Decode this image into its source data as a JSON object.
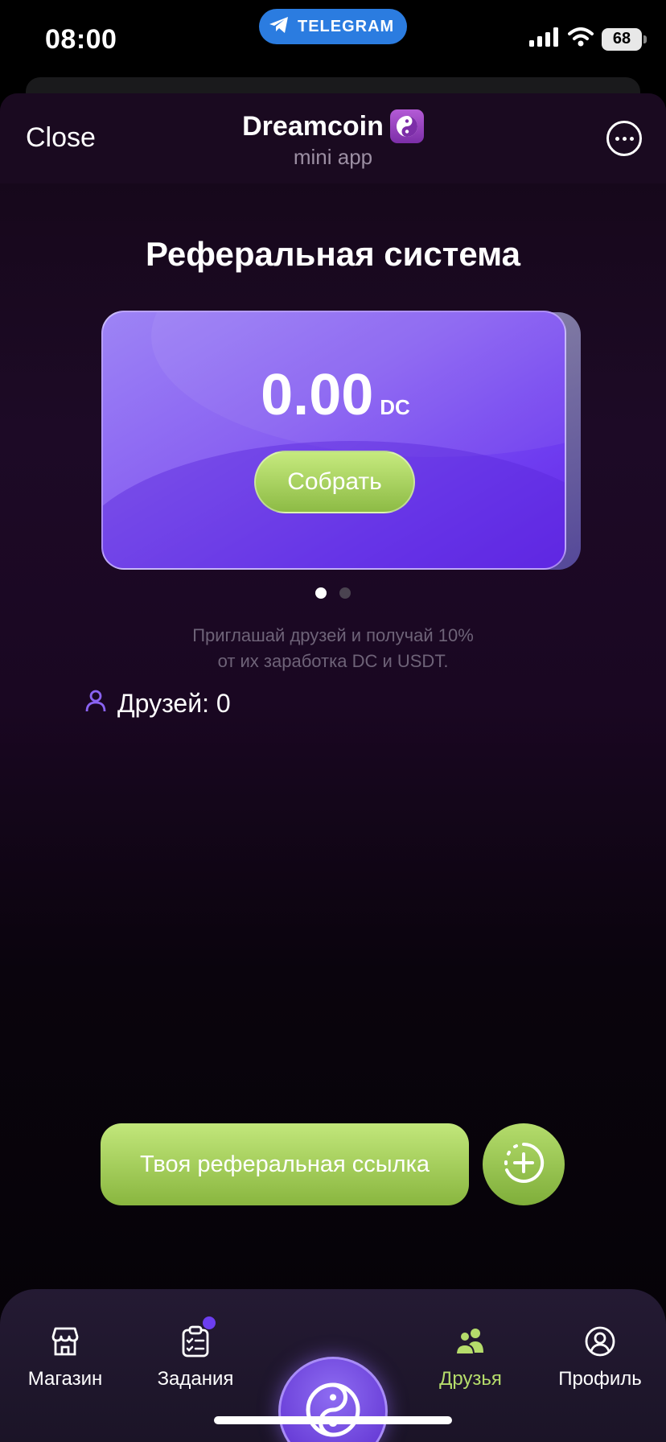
{
  "status_bar": {
    "time": "08:00",
    "pill_label": "TELEGRAM",
    "battery": "68",
    "icons": [
      "signal-icon",
      "wifi-icon",
      "battery-icon"
    ]
  },
  "header": {
    "close_label": "Close",
    "title": "Dreamcoin",
    "subtitle": "mini app",
    "more_icon": "more-icon"
  },
  "page": {
    "title": "Реферальная система"
  },
  "card": {
    "amount": "0.00",
    "unit": "DC",
    "collect_label": "Собрать"
  },
  "carousel": {
    "pages": 2,
    "active_index": 0
  },
  "invite": {
    "line1": "Приглашай друзей и получай 10%",
    "line2": "от их заработка DC и USDT."
  },
  "friends": {
    "label": "Друзей: 0"
  },
  "actions": {
    "ref_link_label": "Твоя реферальная ссылка",
    "add_icon": "add-icon"
  },
  "tabbar": {
    "items": [
      {
        "label": "Магазин",
        "icon": "shop-icon"
      },
      {
        "label": "Задания",
        "icon": "tasks-icon"
      },
      {
        "label": "Друзья",
        "icon": "friends-icon"
      },
      {
        "label": "Профиль",
        "icon": "profile-icon"
      }
    ],
    "active_label": "Друзья",
    "center_icon": "yin-yang-icon"
  },
  "colors": {
    "accent_green": "#b5dc6b",
    "accent_purple": "#6c3ef0"
  }
}
